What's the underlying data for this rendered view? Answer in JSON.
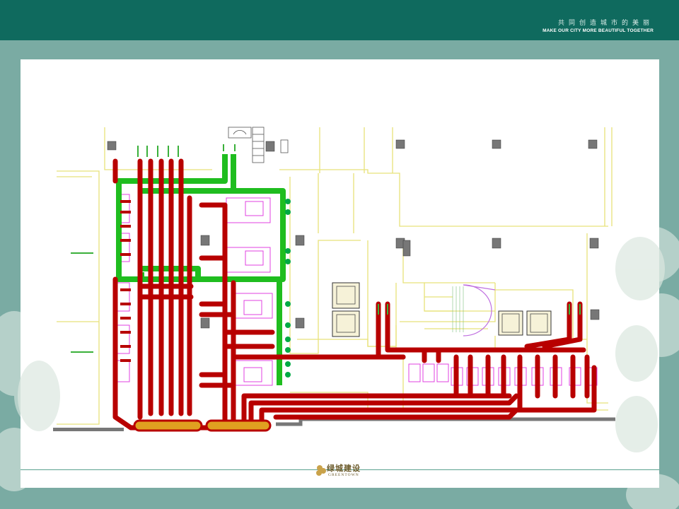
{
  "header": {
    "tagline_cn": "共同创造城市的美丽",
    "tagline_en": "MAKE OUR CITY MORE BEAUTIFUL TOGETHER"
  },
  "footer": {
    "logo_cn": "绿城建设",
    "logo_en": "GREENTOWN"
  },
  "colors": {
    "header": "#0f6a5e",
    "background": "#7aaba3",
    "pipe_red": "#c40000",
    "pipe_green": "#1fbd1f",
    "wall_yellow": "#e8e27a",
    "equipment_magenta": "#e040e0"
  }
}
